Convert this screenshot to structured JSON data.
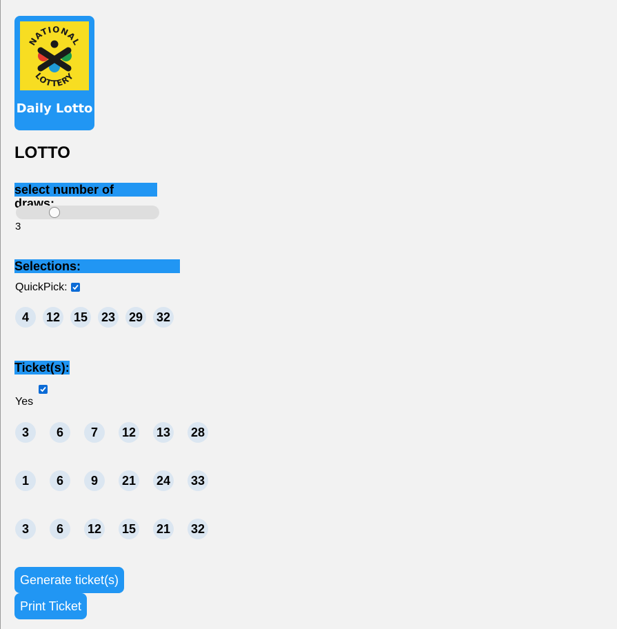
{
  "logo": {
    "brand_text_top": "NATIONAL",
    "brand_text_bottom": "LOTTERY",
    "caption": "Daily Lotto",
    "colors": {
      "card": "#2196f3",
      "logo_bg": "#f7dd22",
      "x_mark": "#1a1a1a",
      "red": "#e63a2e",
      "green": "#1e9b4b",
      "blue": "#1f9ad6"
    }
  },
  "title": "LOTTO",
  "draws": {
    "label": "select number of draws:",
    "value": "3",
    "slider_fraction": 0.25
  },
  "selections": {
    "label": "Selections:",
    "quickpick_label": "QuickPick:",
    "quickpick_checked": true,
    "numbers": [
      "4",
      "12",
      "15",
      "23",
      "29",
      "32"
    ]
  },
  "tickets": {
    "label": "Ticket(s):",
    "yes_label": "Yes",
    "yes_checked": true,
    "rows": [
      [
        "3",
        "6",
        "7",
        "12",
        "13",
        "28"
      ],
      [
        "1",
        "6",
        "9",
        "21",
        "24",
        "33"
      ],
      [
        "3",
        "6",
        "12",
        "15",
        "21",
        "32"
      ]
    ]
  },
  "buttons": {
    "generate": "Generate ticket(s)",
    "print": "Print Ticket"
  },
  "colors": {
    "accent": "#2196f3",
    "ball_bg": "#dbe6f1",
    "checkbox": "#0b6bd6",
    "page_bg": "#f2f2f2"
  }
}
